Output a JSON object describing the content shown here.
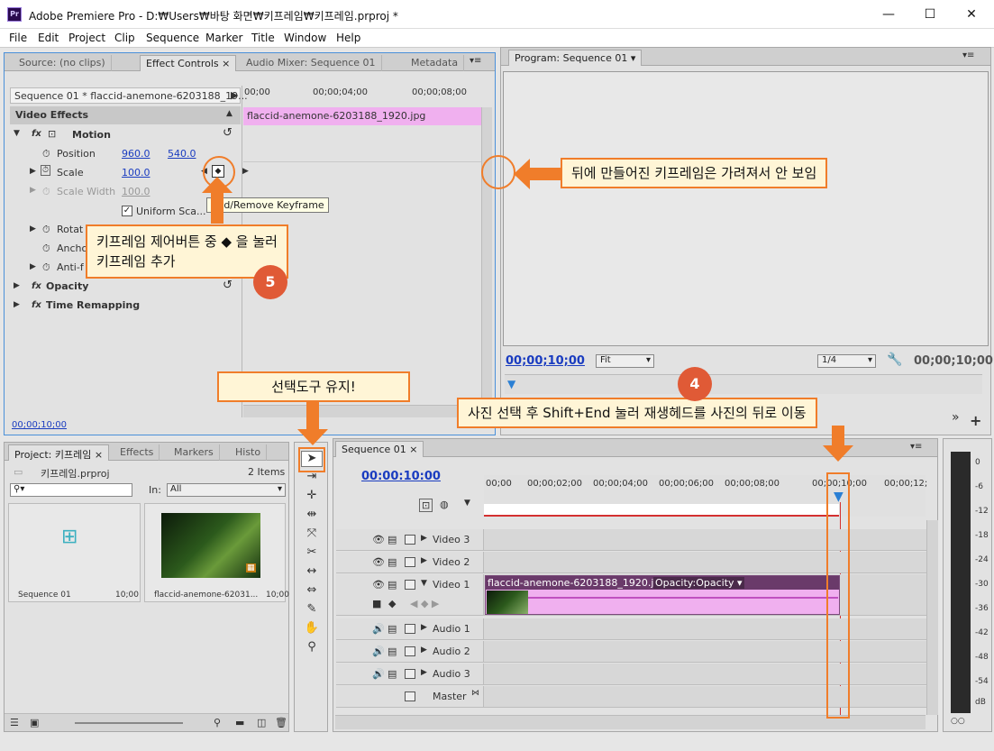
{
  "titlebar": {
    "app_icon": "Pr",
    "title": "Adobe Premiere Pro - D:₩Users₩바탕 화면₩키프레임₩키프레임.prproj *",
    "min": "—",
    "max": "☐",
    "close": "✕"
  },
  "menus": [
    "File",
    "Edit",
    "Project",
    "Clip",
    "Sequence",
    "Marker",
    "Title",
    "Window",
    "Help"
  ],
  "source_panel": {
    "tabs": [
      "Source: (no clips)",
      "Effect Controls",
      "Audio Mixer: Sequence 01",
      "Metadata"
    ],
    "tab_close": "×"
  },
  "effect_controls": {
    "clip_header": "Sequence 01 * flaccid-anemone-6203188_19...",
    "ruler": [
      "00;00",
      "00;00;04;00",
      "00;00;08;00"
    ],
    "clip_bar": "flaccid-anemone-6203188_1920.jpg",
    "video_effects": "Video Effects",
    "motion": "Motion",
    "position_label": "Position",
    "position_x": "960.0",
    "position_y": "540.0",
    "scale_label": "Scale",
    "scale_value": "100.0",
    "scale_width_label": "Scale Width",
    "scale_width_value": "100.0",
    "uniform_scale": "Uniform Sca...",
    "rotation": "Rotat",
    "anchor": "Ancho",
    "anti_flicker": "Anti-f",
    "opacity": "Opacity",
    "time_remap": "Time Remapping",
    "tooltip": "Add/Remove Keyframe",
    "timecode": "00;00;10;00",
    "fx": "fx"
  },
  "program": {
    "tab": "Program: Sequence 01",
    "timecode": "00;00;10;00",
    "fit": "Fit",
    "quality": "1/4",
    "duration": "00;00;10;00"
  },
  "project": {
    "tabs": [
      "Project: 키프레임",
      "Effects",
      "Markers",
      "Histo"
    ],
    "file": "키프레임.prproj",
    "items_count": "2 Items",
    "in_label": "In:",
    "in_value": "All",
    "seq_name": "Sequence 01",
    "seq_dur": "10;00",
    "img_name": "flaccid-anemone-62031...",
    "img_dur": "10;00"
  },
  "timeline": {
    "tab": "Sequence 01",
    "timecode": "00:00:10:00",
    "ruler": [
      "00;00",
      "00;00;02;00",
      "00;00;04;00",
      "00;00;06;00",
      "00;00;08;00",
      "00;00;10;00",
      "00;00;12;"
    ],
    "tracks": [
      "Video 3",
      "Video 2",
      "Video 1",
      "Audio 1",
      "Audio 2",
      "Audio 3",
      "Master"
    ],
    "clip_name": "flaccid-anemone-6203188_1920.jpg",
    "clip_fx": "Opacity:Opacity ▾"
  },
  "vu": {
    "ticks": [
      "0",
      "-6",
      "-12",
      "-18",
      "-24",
      "-30",
      "-36",
      "-42",
      "-48",
      "-54",
      "dB"
    ]
  },
  "callouts": {
    "hidden_keyframe": "뒤에 만들어진 키프레임은 가려져서 안 보임",
    "add_keyframe_line1": "키프레임 제어버튼 중 ◆ 을 눌러",
    "add_keyframe_line2": "키프레임 추가",
    "step5": "5",
    "keep_tool": "선택도구 유지!",
    "move_playhead": "사진 선택 후 Shift+End 눌러 재생헤드를 사진의 뒤로 이동",
    "step4": "4"
  },
  "colors": {
    "accent": "#f07d2a",
    "badge": "#e05a36",
    "clip_pink": "#f0b0ef",
    "clip_header": "#6a3a6a",
    "timecode": "#1a3cc0"
  }
}
